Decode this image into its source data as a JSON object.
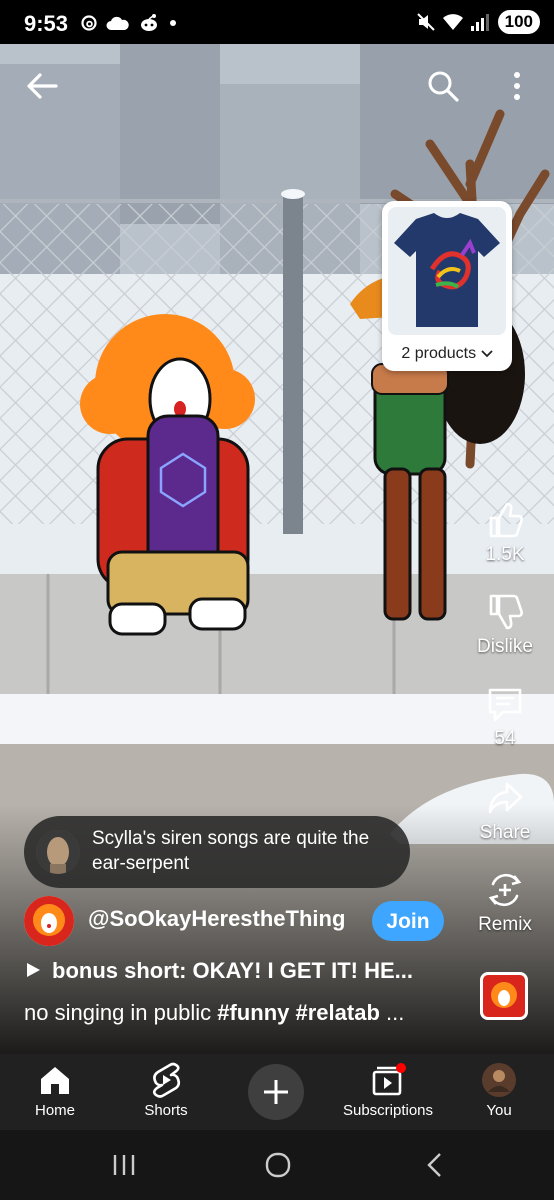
{
  "status_bar": {
    "time": "9:53",
    "battery": "100",
    "left_icons": [
      "threads-icon",
      "cloud-icon",
      "reddit-icon",
      "dot-icon"
    ],
    "right_icons": [
      "mute-icon",
      "wifi-icon",
      "signal-icon"
    ]
  },
  "top_bar": {
    "icons": [
      "back-arrow-icon",
      "search-icon",
      "more-vert-icon"
    ]
  },
  "product_card": {
    "label": "2 products"
  },
  "actions": {
    "like_count": "1.5K",
    "dislike_label": "Dislike",
    "comments_count": "54",
    "share_label": "Share",
    "remix_label": "Remix"
  },
  "comment": {
    "text": "Scylla's siren songs are quite the ear-serpent"
  },
  "channel": {
    "name": "@SoOkayHerestheThing",
    "join_label": "Join"
  },
  "video": {
    "title": "bonus short: OKAY! I GET IT! HE...",
    "desc_prefix": "no singing in public ",
    "tag1": "#funny",
    "tag2": "#relatab",
    "desc_suffix": " ..."
  },
  "bottom_nav": {
    "items": [
      {
        "label": "Home",
        "icon": "home-icon"
      },
      {
        "label": "Shorts",
        "icon": "shorts-icon"
      },
      {
        "label": "",
        "icon": "plus-icon"
      },
      {
        "label": "Subscriptions",
        "icon": "subscriptions-icon"
      },
      {
        "label": "You",
        "icon": "avatar"
      }
    ]
  },
  "system_nav": {
    "icons": [
      "recents-icon",
      "home-circle-icon",
      "back-chevron-icon"
    ]
  },
  "colors": {
    "join_blue": "#3ea6ff",
    "nav_bg": "#212121",
    "notification_red": "#ff0000"
  }
}
